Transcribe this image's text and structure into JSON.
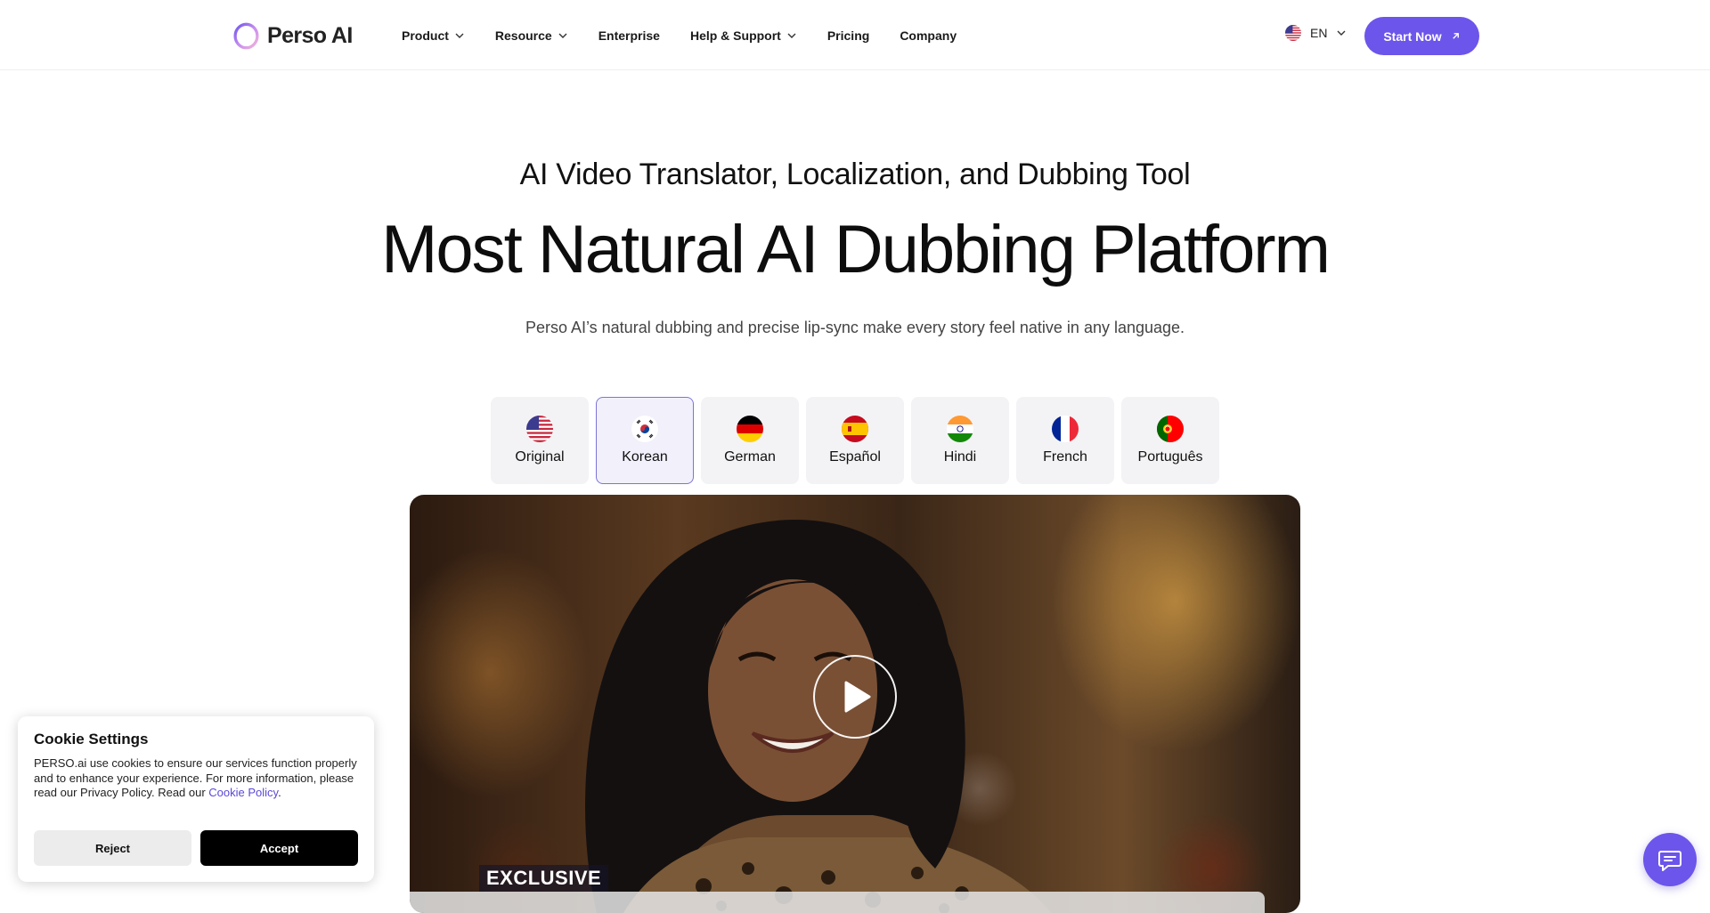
{
  "brand": {
    "name": "Perso AI",
    "accent": "#6c55ea"
  },
  "nav": {
    "items": [
      {
        "label": "Product",
        "has_dropdown": true
      },
      {
        "label": "Resource",
        "has_dropdown": true
      },
      {
        "label": "Enterprise",
        "has_dropdown": false
      },
      {
        "label": "Help & Support",
        "has_dropdown": true
      },
      {
        "label": "Pricing",
        "has_dropdown": false
      },
      {
        "label": "Company",
        "has_dropdown": false
      }
    ],
    "language": "EN",
    "language_flag": "us-flag-icon",
    "cta_label": "Start Now"
  },
  "hero": {
    "eyebrow": "AI Video Translator, Localization, and Dubbing Tool",
    "headline": "Most Natural AI Dubbing Platform",
    "subline": "Perso AI’s natural dubbing and precise lip-sync make every story feel native in any language."
  },
  "languages": {
    "selected": "Korean",
    "tabs": [
      {
        "label": "Original",
        "flag": "us-flag-icon"
      },
      {
        "label": "Korean",
        "flag": "kr-flag-icon"
      },
      {
        "label": "German",
        "flag": "de-flag-icon"
      },
      {
        "label": "Español",
        "flag": "es-flag-icon"
      },
      {
        "label": "Hindi",
        "flag": "in-flag-icon"
      },
      {
        "label": "French",
        "flag": "fr-flag-icon"
      },
      {
        "label": "Português",
        "flag": "pt-flag-icon"
      }
    ]
  },
  "video": {
    "caption": "EXCLUSIVE",
    "state": "paused"
  },
  "cookie": {
    "title": "Cookie Settings",
    "body": "PERSO.ai use cookies to ensure our services function properly and to enhance your experience. For more information, please read our Privacy Policy. Read our ",
    "link_label": "Cookie Policy",
    "link_suffix": ".",
    "reject_label": "Reject",
    "accept_label": "Accept"
  },
  "chat": {
    "icon": "chat-icon"
  }
}
